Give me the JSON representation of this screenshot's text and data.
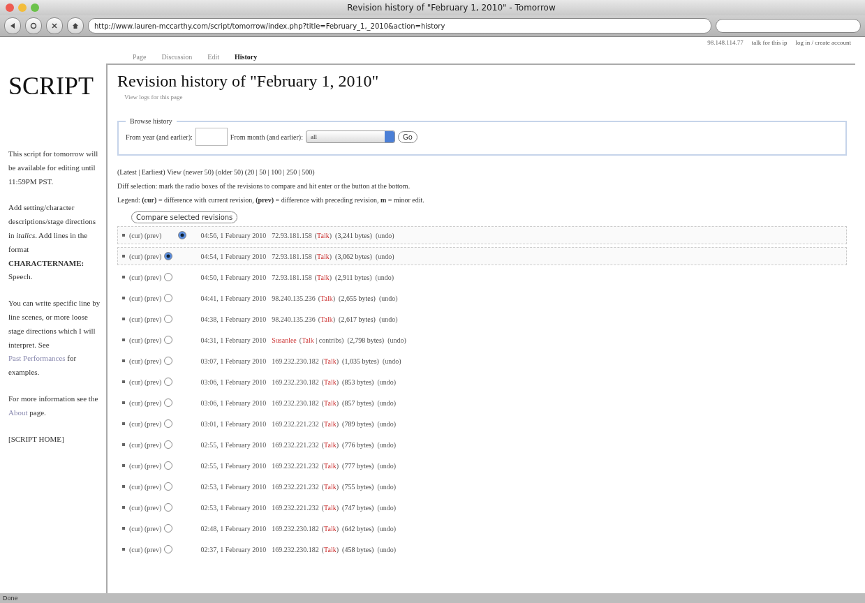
{
  "window": {
    "title": "Revision history of \"February 1, 2010\" - Tomorrow"
  },
  "toolbar": {
    "url": "http://www.lauren-mccarthy.com/script/tomorrow/index.php?title=February_1,_2010&action=history"
  },
  "personal": {
    "ip": "98.148.114.77",
    "links": [
      "talk for this ip",
      "log in / create account"
    ]
  },
  "tabs": [
    {
      "label": "Page",
      "selected": false
    },
    {
      "label": "Discussion",
      "selected": false
    },
    {
      "label": "Edit",
      "selected": false
    },
    {
      "label": "History",
      "selected": true
    }
  ],
  "sidebar": {
    "logo": "SCRIPT",
    "paragraphs": [
      "This script for tomorrow will be available for editing until 11:59PM PST.",
      "Add setting/character descriptions/stage directions in *italics*. Add lines in the format **CHARACTERNAME:** Speech."
    ],
    "links_paragraph": {
      "before": "You can write specific line by line scenes, or more loose stage directions which I will interpret. See",
      "link": "Past Performances",
      "after": "for examples."
    },
    "info_paragraph": {
      "before": "For more information see the",
      "link": "About",
      "after": "page."
    },
    "home": "[SCRIPT HOME]"
  },
  "heading": "Revision history of \"February 1, 2010\"",
  "sublink": "View logs for this page",
  "browse": {
    "legend": "Browse history",
    "year_label": "From year (and earlier):",
    "month_label": "From month (and earlier):",
    "month_value": "all",
    "go": "Go"
  },
  "nav": "(Latest | Earliest) View (newer 50) (older 50) (20 | 50 | 100 | 250 | 500)",
  "diff_note": "Diff selection: mark the radio boxes of the revisions to compare and hit enter or the button at the bottom.",
  "legend": "Legend: **(cur)** = difference with current revision, **(prev)** = difference with preceding revision, **m** = minor edit.",
  "compare_button": "Compare selected revisions",
  "revisions": [
    {
      "cur": "(cur)",
      "prev": "(prev)",
      "radio": {
        "kind": "right",
        "selected": true
      },
      "selected": true,
      "time": "04:56, 1 February 2010",
      "user": "72.93.181.158",
      "tools_open": "(",
      "talk": "Talk",
      "tools_close": ")",
      "size": "(3,241 bytes)",
      "undo": "(undo)"
    },
    {
      "cur": "(cur)",
      "prev": "(prev)",
      "radio": {
        "kind": "left",
        "selected": true
      },
      "selected": true,
      "time": "04:54, 1 February 2010",
      "user": "72.93.181.158",
      "tools_open": "(",
      "talk": "Talk",
      "tools_close": ")",
      "size": "(3,062 bytes)",
      "undo": "(undo)"
    },
    {
      "cur": "(cur)",
      "prev": "(prev)",
      "radio": {
        "kind": "left",
        "selected": false
      },
      "selected": false,
      "time": "04:50, 1 February 2010",
      "user": "72.93.181.158",
      "tools_open": "(",
      "talk": "Talk",
      "tools_close": ")",
      "size": "(2,911 bytes)",
      "undo": "(undo)"
    },
    {
      "cur": "(cur)",
      "prev": "(prev)",
      "radio": {
        "kind": "left",
        "selected": false
      },
      "selected": false,
      "time": "04:41, 1 February 2010",
      "user": "98.240.135.236",
      "tools_open": "(",
      "talk": "Talk",
      "tools_close": ")",
      "size": "(2,655 bytes)",
      "undo": "(undo)"
    },
    {
      "cur": "(cur)",
      "prev": "(prev)",
      "radio": {
        "kind": "left",
        "selected": false
      },
      "selected": false,
      "time": "04:38, 1 February 2010",
      "user": "98.240.135.236",
      "tools_open": "(",
      "talk": "Talk",
      "tools_close": ")",
      "size": "(2,617 bytes)",
      "undo": "(undo)"
    },
    {
      "cur": "(cur)",
      "prev": "(prev)",
      "radio": {
        "kind": "left",
        "selected": false
      },
      "selected": false,
      "time": "04:31, 1 February 2010",
      "user": "Susanlee",
      "user_link": true,
      "tools_open": "(",
      "talk": "Talk",
      "tools_sep": " | ",
      "contribs": "contribs",
      "tools_close": ")",
      "size": "(2,798 bytes)",
      "undo": "(undo)"
    },
    {
      "cur": "(cur)",
      "prev": "(prev)",
      "radio": {
        "kind": "left",
        "selected": false
      },
      "selected": false,
      "time": "03:07, 1 February 2010",
      "user": "169.232.230.182",
      "tools_open": "(",
      "talk": "Talk",
      "tools_close": ")",
      "size": "(1,035 bytes)",
      "undo": "(undo)"
    },
    {
      "cur": "(cur)",
      "prev": "(prev)",
      "radio": {
        "kind": "left",
        "selected": false
      },
      "selected": false,
      "time": "03:06, 1 February 2010",
      "user": "169.232.230.182",
      "tools_open": "(",
      "talk": "Talk",
      "tools_close": ")",
      "size": "(853 bytes)",
      "undo": "(undo)"
    },
    {
      "cur": "(cur)",
      "prev": "(prev)",
      "radio": {
        "kind": "left",
        "selected": false
      },
      "selected": false,
      "time": "03:06, 1 February 2010",
      "user": "169.232.230.182",
      "tools_open": "(",
      "talk": "Talk",
      "tools_close": ")",
      "size": "(857 bytes)",
      "undo": "(undo)"
    },
    {
      "cur": "(cur)",
      "prev": "(prev)",
      "radio": {
        "kind": "left",
        "selected": false
      },
      "selected": false,
      "time": "03:01, 1 February 2010",
      "user": "169.232.221.232",
      "tools_open": "(",
      "talk": "Talk",
      "tools_close": ")",
      "size": "(789 bytes)",
      "undo": "(undo)"
    },
    {
      "cur": "(cur)",
      "prev": "(prev)",
      "radio": {
        "kind": "left",
        "selected": false
      },
      "selected": false,
      "time": "02:55, 1 February 2010",
      "user": "169.232.221.232",
      "tools_open": "(",
      "talk": "Talk",
      "tools_close": ")",
      "size": "(776 bytes)",
      "undo": "(undo)"
    },
    {
      "cur": "(cur)",
      "prev": "(prev)",
      "radio": {
        "kind": "left",
        "selected": false
      },
      "selected": false,
      "time": "02:55, 1 February 2010",
      "user": "169.232.221.232",
      "tools_open": "(",
      "talk": "Talk",
      "tools_close": ")",
      "size": "(777 bytes)",
      "undo": "(undo)"
    },
    {
      "cur": "(cur)",
      "prev": "(prev)",
      "radio": {
        "kind": "left",
        "selected": false
      },
      "selected": false,
      "time": "02:53, 1 February 2010",
      "user": "169.232.221.232",
      "tools_open": "(",
      "talk": "Talk",
      "tools_close": ")",
      "size": "(755 bytes)",
      "undo": "(undo)"
    },
    {
      "cur": "(cur)",
      "prev": "(prev)",
      "radio": {
        "kind": "left",
        "selected": false
      },
      "selected": false,
      "time": "02:53, 1 February 2010",
      "user": "169.232.221.232",
      "tools_open": "(",
      "talk": "Talk",
      "tools_close": ")",
      "size": "(747 bytes)",
      "undo": "(undo)"
    },
    {
      "cur": "(cur)",
      "prev": "(prev)",
      "radio": {
        "kind": "left",
        "selected": false
      },
      "selected": false,
      "time": "02:48, 1 February 2010",
      "user": "169.232.230.182",
      "tools_open": "(",
      "talk": "Talk",
      "tools_close": ")",
      "size": "(642 bytes)",
      "undo": "(undo)"
    },
    {
      "cur": "(cur)",
      "prev": "(prev)",
      "radio": {
        "kind": "left",
        "selected": false
      },
      "selected": false,
      "time": "02:37, 1 February 2010",
      "user": "169.232.230.182",
      "tools_open": "(",
      "talk": "Talk",
      "tools_close": ")",
      "size": "(458 bytes)",
      "undo": "(undo)"
    }
  ],
  "status_bar": "Done"
}
